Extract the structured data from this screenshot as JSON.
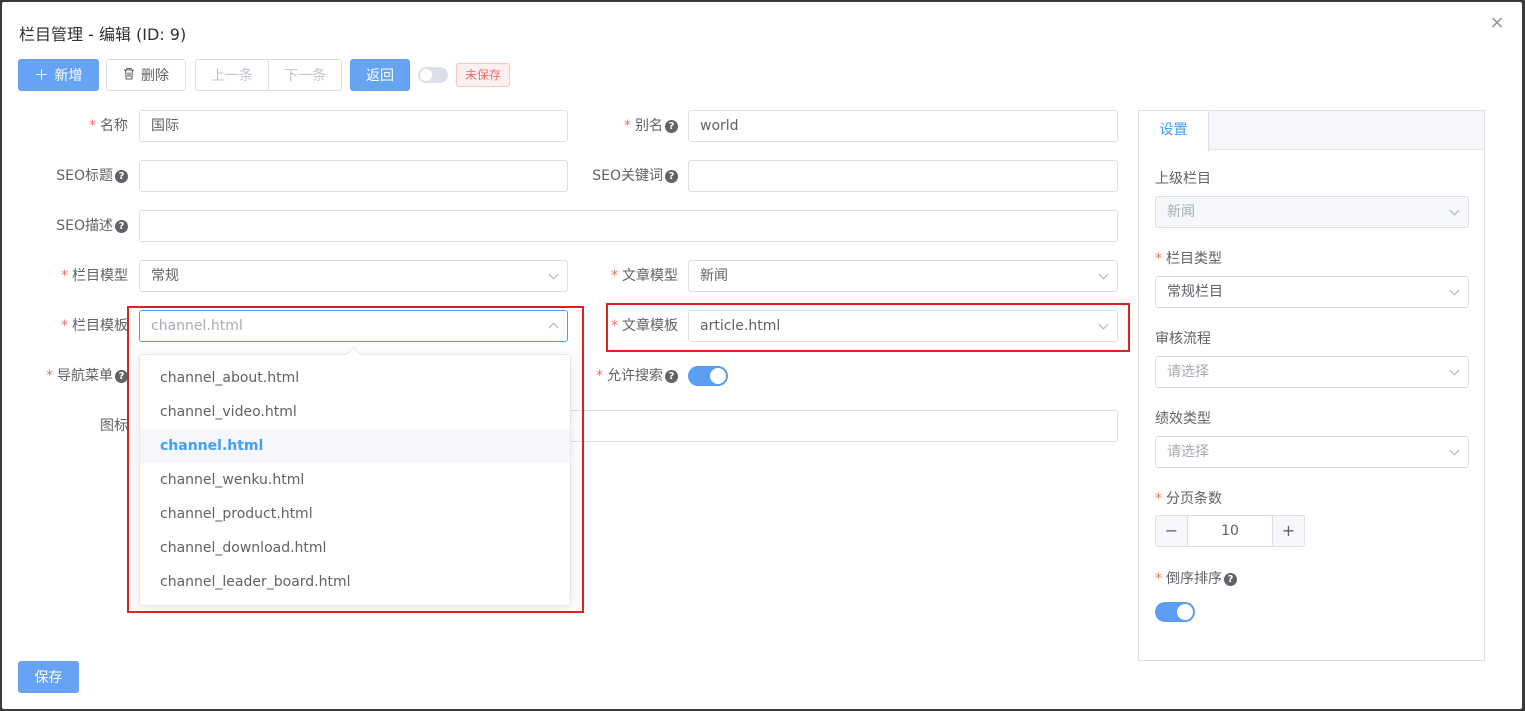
{
  "dialog": {
    "title": "栏目管理 - 编辑 (ID: 9)",
    "close_icon": "×"
  },
  "toolbar": {
    "add_label": "新增",
    "delete_label": "删除",
    "prev_label": "上一条",
    "next_label": "下一条",
    "back_label": "返回",
    "unsaved_tag": "未保存"
  },
  "form": {
    "name": {
      "label": "名称",
      "value": "国际"
    },
    "alias": {
      "label": "别名",
      "value": "world"
    },
    "seo_title": {
      "label": "SEO标题",
      "value": ""
    },
    "seo_keywords": {
      "label": "SEO关键词",
      "value": ""
    },
    "seo_desc": {
      "label": "SEO描述",
      "value": ""
    },
    "channel_model": {
      "label": "栏目模型",
      "value": "常规"
    },
    "article_model": {
      "label": "文章模型",
      "value": "新闻"
    },
    "channel_template": {
      "label": "栏目模板",
      "placeholder": "channel.html"
    },
    "article_template": {
      "label": "文章模板",
      "value": "article.html"
    },
    "nav_menu": {
      "label": "导航菜单"
    },
    "allow_search": {
      "label": "允许搜索",
      "on": true
    },
    "icon": {
      "label": "图标"
    }
  },
  "dropdown": {
    "items": [
      "channel_about.html",
      "channel_video.html",
      "channel.html",
      "channel_wenku.html",
      "channel_product.html",
      "channel_download.html",
      "channel_leader_board.html"
    ],
    "selected": "channel.html"
  },
  "panel": {
    "tab": "设置",
    "parent": {
      "label": "上级栏目",
      "value": "新闻"
    },
    "type": {
      "label": "栏目类型",
      "value": "常规栏目"
    },
    "workflow": {
      "label": "审核流程",
      "placeholder": "请选择"
    },
    "performance": {
      "label": "绩效类型",
      "placeholder": "请选择"
    },
    "page_size": {
      "label": "分页条数",
      "value": "10"
    },
    "desc_order": {
      "label": "倒序排序",
      "on": true
    }
  },
  "footer": {
    "save_label": "保存"
  },
  "colors": {
    "primary": "#66a3f2",
    "danger": "#f56c6c",
    "highlight_box": "#e02020"
  }
}
